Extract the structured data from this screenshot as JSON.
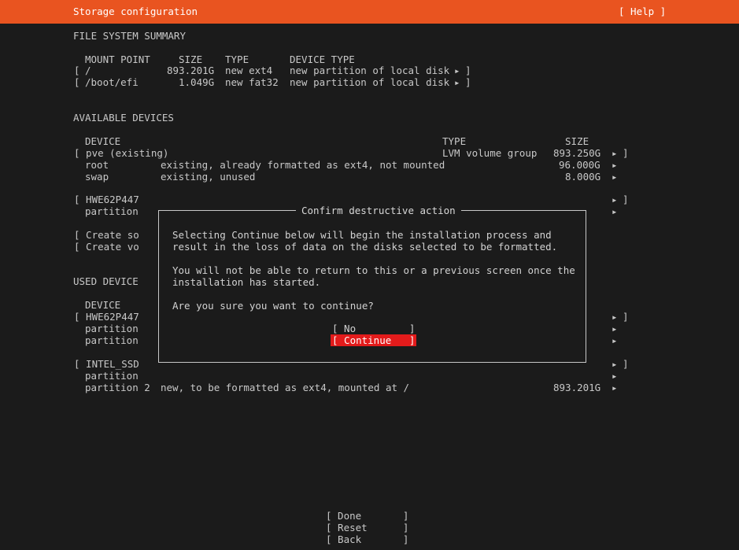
{
  "header": {
    "title": "Storage configuration",
    "help": "[ Help ]"
  },
  "fs_summary": {
    "heading": "FILE SYSTEM SUMMARY",
    "columns": {
      "mount_point": "MOUNT POINT",
      "size": "SIZE",
      "type": "TYPE",
      "device_type": "DEVICE TYPE"
    },
    "rows": [
      {
        "bracket": "[",
        "mount": "/",
        "size": "893.201G",
        "type": "new ext4",
        "device_type": "new partition of local disk",
        "arrow": "▸",
        "end": "]"
      },
      {
        "bracket": "[",
        "mount": "/boot/efi",
        "size": "1.049G",
        "type": "new fat32",
        "device_type": "new partition of local disk",
        "arrow": "▸",
        "end": "]"
      }
    ]
  },
  "available": {
    "heading": "AVAILABLE DEVICES",
    "columns": {
      "device": "DEVICE",
      "type": "TYPE",
      "size": "SIZE"
    },
    "pve": {
      "label": "[ pve (existing)",
      "type": "LVM volume group",
      "size": "893.250G",
      "arrow": "▸",
      "end": "]"
    },
    "root": {
      "name": "root",
      "desc": "existing, already formatted as ext4, not mounted",
      "size": "96.000G",
      "arrow": "▸"
    },
    "swap": {
      "name": "swap",
      "desc": "existing, unused",
      "size": "8.000G",
      "arrow": "▸"
    },
    "hwe": {
      "label": "[ HWE62P447",
      "arrow": "▸",
      "end": "]"
    },
    "hwe_partition": {
      "name": "partition",
      "arrow": "▸"
    },
    "create_sw": "[ Create so",
    "create_vg": "[ Create vo"
  },
  "used": {
    "heading": "USED DEVICE",
    "columns": {
      "device": "DEVICE"
    },
    "hwe": {
      "label": "[ HWE62P447",
      "arrow": "▸",
      "end": "]"
    },
    "hwe_part1": {
      "name": "partition",
      "arrow": "▸"
    },
    "hwe_part2": {
      "name": "partition",
      "arrow": "▸"
    },
    "intel": {
      "label": "[ INTEL_SSD",
      "arrow": "▸",
      "end": "]"
    },
    "intel_part1": {
      "name": "partition",
      "arrow": "▸"
    },
    "intel_part2": {
      "name": "partition 2",
      "desc": "new, to be formatted as ext4, mounted at /",
      "size": "893.201G",
      "arrow": "▸"
    }
  },
  "dialog": {
    "title": "Confirm destructive action",
    "line1": "Selecting Continue below will begin the installation process and",
    "line2": "result in the loss of data on the disks selected to be formatted.",
    "line3": "You will not be able to return to this or a previous screen once the",
    "line4": "installation has started.",
    "question": "Are you sure you want to continue?",
    "no_button": "[ No         ]",
    "continue_button": "[ Continue   ]"
  },
  "bottom": {
    "done": "[ Done       ]",
    "reset": "[ Reset      ]",
    "back": "[ Back       ]"
  },
  "colors": {
    "accent": "#e95420",
    "selected": "#e31b1b",
    "background": "#1b1b1b",
    "text": "#c8c8c8"
  }
}
